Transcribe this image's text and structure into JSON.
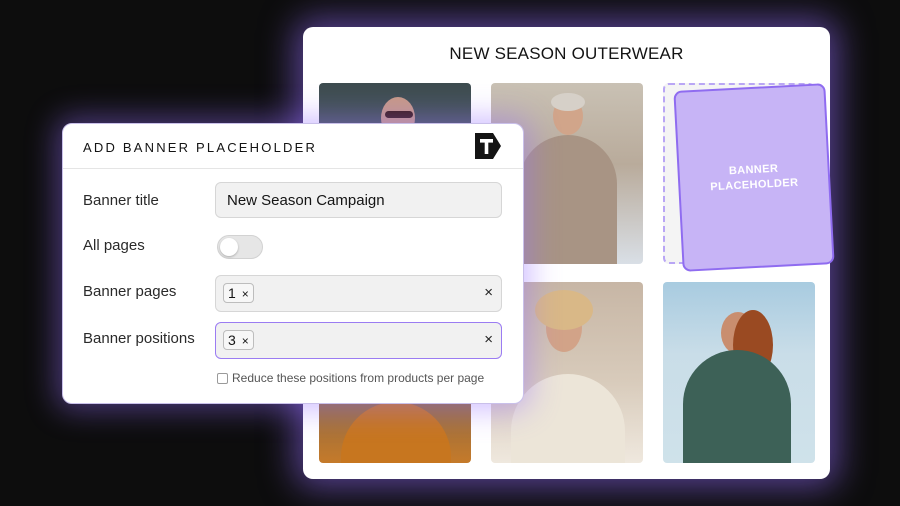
{
  "storefront": {
    "title": "NEW SEASON OUTERWEAR",
    "products": [
      {
        "name": "product-image-1"
      },
      {
        "name": "product-image-2"
      },
      {
        "name": "product-image-3"
      },
      {
        "name": "product-image-4"
      },
      {
        "name": "product-image-5"
      }
    ],
    "banner": {
      "text": "BANNER PLACEHOLDER"
    }
  },
  "dialog": {
    "title": "ADD BANNER PLACEHOLDER",
    "logo_icon": "t-logo-icon",
    "fields": {
      "banner_title": {
        "label": "Banner title",
        "value": "New Season Campaign"
      },
      "all_pages": {
        "label": "All pages",
        "enabled": false
      },
      "banner_pages": {
        "label": "Banner pages",
        "chip": "1",
        "remove": "×",
        "clear": "×"
      },
      "banner_positions": {
        "label": "Banner positions",
        "chip": "3",
        "remove": "×",
        "clear": "×"
      }
    },
    "checkbox": {
      "label": "Reduce these positions from products per page",
      "checked": false
    }
  },
  "colors": {
    "background": "#0d0d0d",
    "accent": "#8f6cf0",
    "banner_fill": "#c7b4f6",
    "glow": "#9670ff"
  }
}
